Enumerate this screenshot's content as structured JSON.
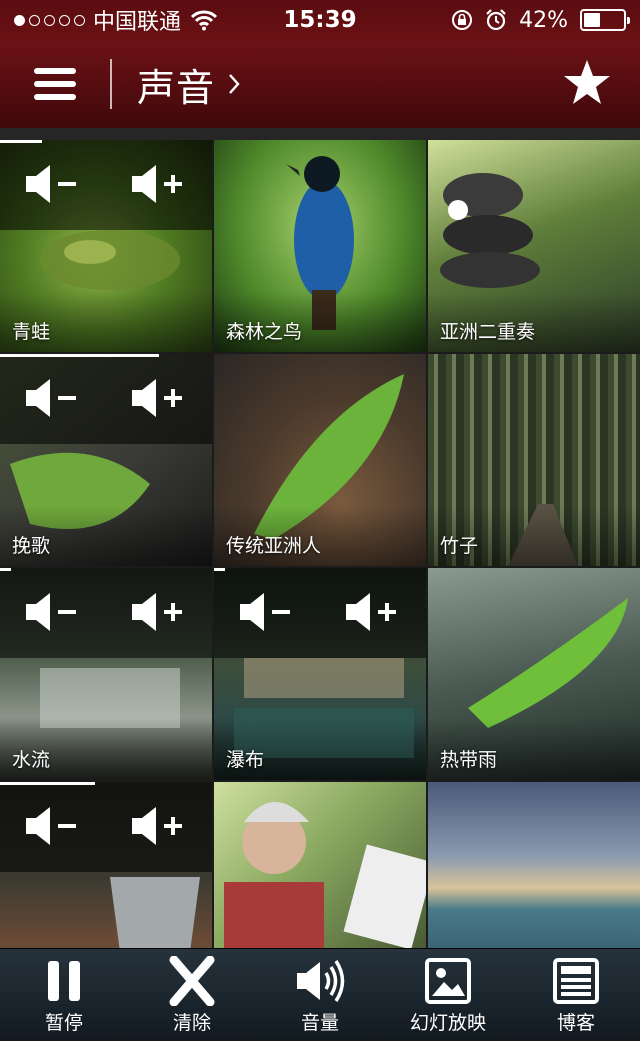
{
  "status_bar": {
    "carrier": "中国联通",
    "time": "15:39",
    "battery": "42%",
    "battery_level": 0.42,
    "signal_bars_filled": 1,
    "signal_bars_total": 5
  },
  "header": {
    "title": "声音"
  },
  "tiles": [
    {
      "label": "青蛙",
      "volume_controls": true,
      "progress": 0.2
    },
    {
      "label": "森林之鸟",
      "volume_controls": false
    },
    {
      "label": "亚洲二重奏",
      "volume_controls": false
    },
    {
      "label": "挽歌",
      "volume_controls": true,
      "progress": 0.75
    },
    {
      "label": "传统亚洲人",
      "volume_controls": false
    },
    {
      "label": "竹子",
      "volume_controls": false
    },
    {
      "label": "水流",
      "volume_controls": true,
      "progress": 0.05
    },
    {
      "label": "瀑布",
      "volume_controls": true,
      "progress": 0.05
    },
    {
      "label": "热带雨",
      "volume_controls": false
    },
    {
      "label": "",
      "volume_controls": true,
      "progress": 0.45
    },
    {
      "label": "",
      "volume_controls": false
    },
    {
      "label": "",
      "volume_controls": false
    }
  ],
  "toolbar": {
    "pause_label": "暂停",
    "clear_label": "清除",
    "volume_label": "音量",
    "slideshow_label": "幻灯放映",
    "blog_label": "博客"
  },
  "icons": {
    "menu": "menu-icon",
    "star": "star-icon",
    "volume_down": "volume-down-icon",
    "volume_up": "volume-up-icon",
    "pause": "pause-icon",
    "clear": "x-icon",
    "volume": "speaker-icon",
    "slideshow": "picture-icon",
    "blog": "newspaper-icon"
  },
  "colors": {
    "header_red": "#6d1216",
    "toolbar_dark": "#1a242c"
  }
}
